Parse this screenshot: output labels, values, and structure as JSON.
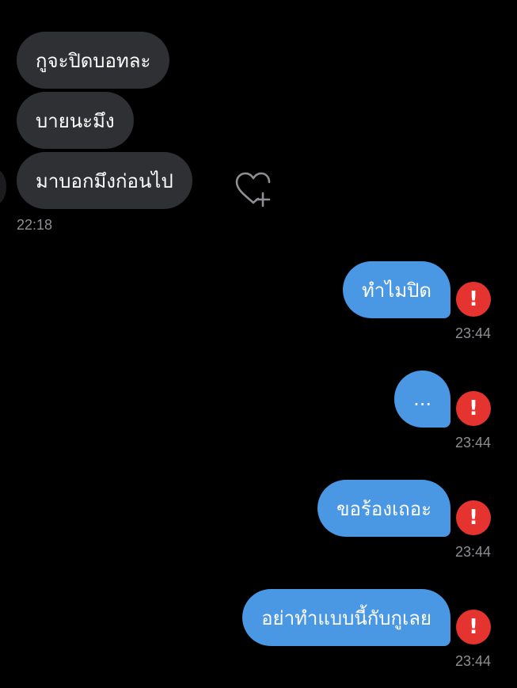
{
  "incoming": {
    "messages": [
      {
        "text": "กูจะปิดบอทละ"
      },
      {
        "text": "บายนะมึง"
      },
      {
        "text": "มาบอกมึงก่อนไป"
      }
    ],
    "timestamp": "22:18",
    "reaction_icon": "heart-plus-icon"
  },
  "outgoing": {
    "messages": [
      {
        "text": "ทำไมปิด",
        "time": "23:44",
        "status": "!"
      },
      {
        "text": "...",
        "time": "23:44",
        "status": "!"
      },
      {
        "text": "ขอร้องเถอะ",
        "time": "23:44",
        "status": "!"
      },
      {
        "text": "อย่าทำแบบนี้กับกูเลย",
        "time": "23:44",
        "status": "!"
      }
    ]
  },
  "colors": {
    "background": "#000000",
    "incoming_bubble": "#2f3033",
    "outgoing_bubble": "#4a97e3",
    "error": "#e5342f",
    "timestamp": "#8e8e93"
  }
}
